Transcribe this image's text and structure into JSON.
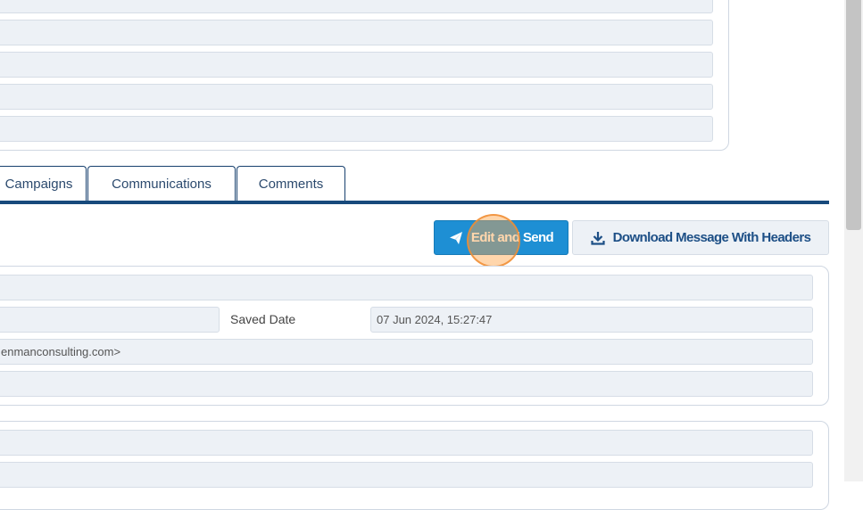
{
  "tabs": [
    {
      "label": "Campaigns"
    },
    {
      "label": "Communications"
    },
    {
      "label": "Comments"
    }
  ],
  "toolbar": {
    "edit_send_label": "Edit and Send",
    "download_label": "Download Message With Headers"
  },
  "message_details": {
    "saved_date_label": "Saved Date",
    "saved_date_value": "07 Jun 2024, 15:27:47",
    "from_value": "enmanconsulting.com>"
  },
  "colors": {
    "accent": "#1e8fd4",
    "tab_line": "#174a7c",
    "field_bg": "#edf1f6"
  },
  "icons": {
    "send": "paper-plane-icon",
    "download": "download-icon"
  }
}
